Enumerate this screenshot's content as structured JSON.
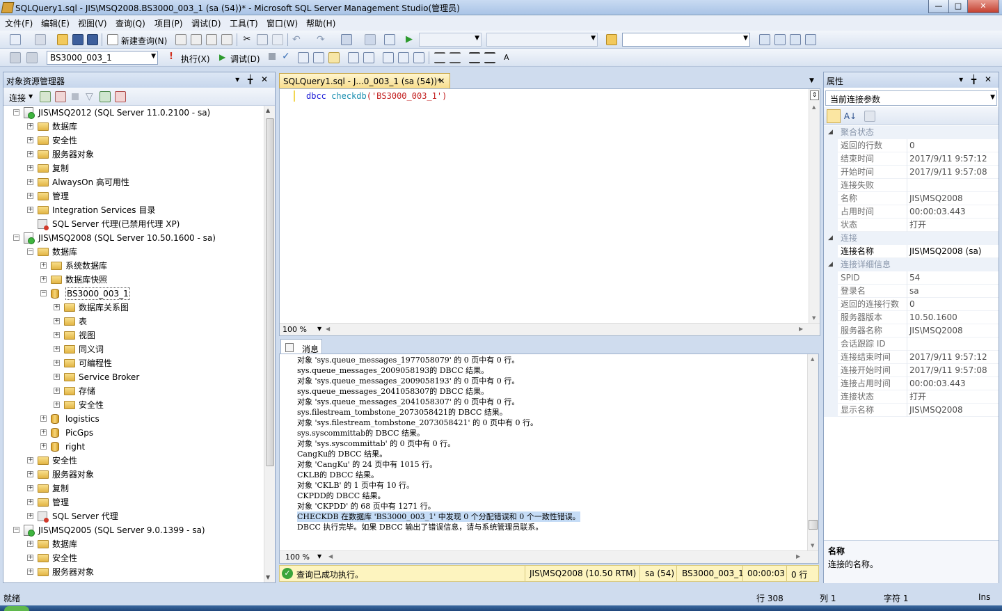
{
  "window": {
    "title": "SQLQuery1.sql - JIS\\MSQ2008.BS3000_003_1 (sa (54))* - Microsoft SQL Server Management Studio(管理员)",
    "minimize": "—",
    "maximize": "□",
    "close": "✕"
  },
  "menu": [
    "文件(F)",
    "编辑(E)",
    "视图(V)",
    "查询(Q)",
    "项目(P)",
    "调试(D)",
    "工具(T)",
    "窗口(W)",
    "帮助(H)"
  ],
  "toolbar1": {
    "new_query": "新建查询(N)"
  },
  "toolbar2": {
    "database": "BS3000_003_1",
    "execute": "执行(X)",
    "debug": "调试(D)"
  },
  "object_explorer": {
    "title": "对象资源管理器",
    "pin": "▾ ╈ ✕",
    "connect": "连接",
    "tree": [
      {
        "label": "JIS\\MSQ2012 (SQL Server 11.0.2100 - sa)",
        "level": 0,
        "icon": "server-icon",
        "exp": "−"
      },
      {
        "label": "数据库",
        "level": 1,
        "icon": "folder-icon",
        "exp": "+"
      },
      {
        "label": "安全性",
        "level": 1,
        "icon": "folder-icon",
        "exp": "+"
      },
      {
        "label": "服务器对象",
        "level": 1,
        "icon": "folder-icon",
        "exp": "+"
      },
      {
        "label": "复制",
        "level": 1,
        "icon": "folder-icon",
        "exp": "+"
      },
      {
        "label": "AlwaysOn 高可用性",
        "level": 1,
        "icon": "folder-icon",
        "exp": "+"
      },
      {
        "label": "管理",
        "level": 1,
        "icon": "folder-icon",
        "exp": "+"
      },
      {
        "label": "Integration Services 目录",
        "level": 1,
        "icon": "folder-icon",
        "exp": "+"
      },
      {
        "label": "SQL Server 代理(已禁用代理 XP)",
        "level": 1,
        "icon": "agent-icon",
        "exp": ""
      },
      {
        "label": "JIS\\MSQ2008 (SQL Server 10.50.1600 - sa)",
        "level": 0,
        "icon": "server-icon",
        "exp": "−"
      },
      {
        "label": "数据库",
        "level": 1,
        "icon": "folder-icon",
        "exp": "−"
      },
      {
        "label": "系统数据库",
        "level": 2,
        "icon": "folder-icon",
        "exp": "+"
      },
      {
        "label": "数据库快照",
        "level": 2,
        "icon": "folder-icon",
        "exp": "+"
      },
      {
        "label": "BS3000_003_1",
        "level": 2,
        "icon": "database-icon",
        "exp": "−",
        "selected": true
      },
      {
        "label": "数据库关系图",
        "level": 3,
        "icon": "folder-icon",
        "exp": "+"
      },
      {
        "label": "表",
        "level": 3,
        "icon": "folder-icon",
        "exp": "+"
      },
      {
        "label": "视图",
        "level": 3,
        "icon": "folder-icon",
        "exp": "+"
      },
      {
        "label": "同义词",
        "level": 3,
        "icon": "folder-icon",
        "exp": "+"
      },
      {
        "label": "可编程性",
        "level": 3,
        "icon": "folder-icon",
        "exp": "+"
      },
      {
        "label": "Service Broker",
        "level": 3,
        "icon": "folder-icon",
        "exp": "+"
      },
      {
        "label": "存储",
        "level": 3,
        "icon": "folder-icon",
        "exp": "+"
      },
      {
        "label": "安全性",
        "level": 3,
        "icon": "folder-icon",
        "exp": "+"
      },
      {
        "label": "logistics",
        "level": 2,
        "icon": "database-icon",
        "exp": "+"
      },
      {
        "label": "PicGps",
        "level": 2,
        "icon": "database-icon",
        "exp": "+"
      },
      {
        "label": "right",
        "level": 2,
        "icon": "database-icon",
        "exp": "+"
      },
      {
        "label": "安全性",
        "level": 1,
        "icon": "folder-icon",
        "exp": "+"
      },
      {
        "label": "服务器对象",
        "level": 1,
        "icon": "folder-icon",
        "exp": "+"
      },
      {
        "label": "复制",
        "level": 1,
        "icon": "folder-icon",
        "exp": "+"
      },
      {
        "label": "管理",
        "level": 1,
        "icon": "folder-icon",
        "exp": "+"
      },
      {
        "label": "SQL Server 代理",
        "level": 1,
        "icon": "agent-icon",
        "exp": "+"
      },
      {
        "label": "JIS\\MSQ2005 (SQL Server 9.0.1399 - sa)",
        "level": 0,
        "icon": "server-icon",
        "exp": "−"
      },
      {
        "label": "数据库",
        "level": 1,
        "icon": "folder-icon",
        "exp": "+"
      },
      {
        "label": "安全性",
        "level": 1,
        "icon": "folder-icon",
        "exp": "+"
      },
      {
        "label": "服务器对象",
        "level": 1,
        "icon": "folder-icon",
        "exp": "+"
      }
    ]
  },
  "editor": {
    "tab_title": "SQLQuery1.sql - J...0_003_1 (sa (54))*",
    "tab_close": "✕",
    "code_keyword": "dbcc",
    "code_function": "checkdb",
    "code_args": "('BS3000_003_1')",
    "zoom": "100 %"
  },
  "messages": {
    "tab": "消息",
    "zoom": "100 %",
    "lines": [
      "对象 'sys.queue_messages_1977058079' 的 0 页中有 0 行。",
      "sys.queue_messages_2009058193的 DBCC 结果。",
      "对象 'sys.queue_messages_2009058193' 的 0 页中有 0 行。",
      "sys.queue_messages_2041058307的 DBCC 结果。",
      "对象 'sys.queue_messages_2041058307' 的 0 页中有 0 行。",
      "sys.filestream_tombstone_2073058421的 DBCC 结果。",
      "对象 'sys.filestream_tombstone_2073058421' 的 0 页中有 0 行。",
      "sys.syscommittab的 DBCC 结果。",
      "对象 'sys.syscommittab' 的 0 页中有 0 行。",
      "CangKu的 DBCC 结果。",
      "对象 'CangKu' 的 24 页中有 1015 行。",
      "CKLB的 DBCC 结果。",
      "对象 'CKLB' 的 1 页中有 10 行。",
      "CKPDD的 DBCC 结果。",
      "对象 'CKPDD' 的 68 页中有 1271 行。",
      "CHECKDB 在数据库 'BS3000_003_1' 中发现 0 个分配错误和 0 个一致性错误。",
      "DBCC 执行完毕。如果 DBCC 输出了错误信息，请与系统管理员联系。"
    ],
    "highlighted_index": 15
  },
  "query_status": {
    "text": "查询已成功执行。",
    "server": "JIS\\MSQ2008 (10.50 RTM)",
    "user": "sa (54)",
    "database": "BS3000_003_1",
    "elapsed": "00:00:03",
    "rows": "0 行"
  },
  "properties": {
    "title": "属性",
    "pin": "▾ ╈ ✕",
    "selector": "当前连接参数",
    "rows": [
      {
        "type": "cat",
        "name": "聚合状态"
      },
      {
        "name": "返回的行数",
        "value": "0"
      },
      {
        "name": "结束时间",
        "value": "2017/9/11 9:57:12"
      },
      {
        "name": "开始时间",
        "value": "2017/9/11 9:57:08"
      },
      {
        "name": "连接失败",
        "value": ""
      },
      {
        "name": "名称",
        "value": "JIS\\MSQ2008"
      },
      {
        "name": "占用时间",
        "value": "00:00:03.443"
      },
      {
        "name": "状态",
        "value": "打开"
      },
      {
        "type": "cat",
        "name": "连接"
      },
      {
        "name": "连接名称",
        "value": "JIS\\MSQ2008 (sa)",
        "dark": true
      },
      {
        "type": "cat",
        "name": "连接详细信息"
      },
      {
        "name": "SPID",
        "value": "54"
      },
      {
        "name": "登录名",
        "value": "sa"
      },
      {
        "name": "返回的连接行数",
        "value": "0"
      },
      {
        "name": "服务器版本",
        "value": "10.50.1600"
      },
      {
        "name": "服务器名称",
        "value": "JIS\\MSQ2008"
      },
      {
        "name": "会话跟踪 ID",
        "value": ""
      },
      {
        "name": "连接结束时间",
        "value": "2017/9/11 9:57:12"
      },
      {
        "name": "连接开始时间",
        "value": "2017/9/11 9:57:08"
      },
      {
        "name": "连接占用时间",
        "value": "00:00:03.443"
      },
      {
        "name": "连接状态",
        "value": "打开"
      },
      {
        "name": "显示名称",
        "value": "JIS\\MSQ2008"
      }
    ],
    "desc_title": "名称",
    "desc_text": "连接的名称。"
  },
  "statusbar": {
    "ready": "就绪",
    "line": "行 308",
    "col": "列 1",
    "char": "字符 1",
    "ins": "Ins"
  }
}
